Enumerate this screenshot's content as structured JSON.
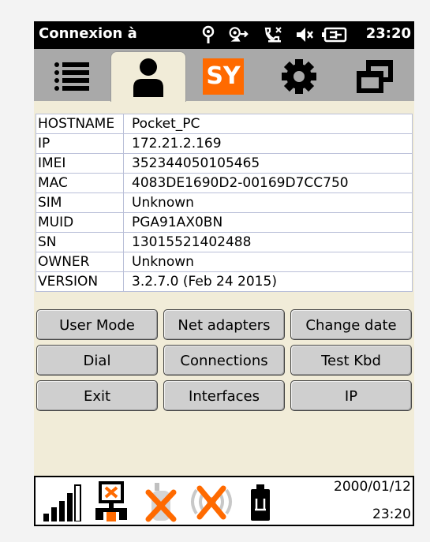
{
  "status_bar": {
    "title": "Connexion à",
    "time": "23:20",
    "icons": [
      "antenna-icon",
      "sync-icon",
      "phone-icon",
      "speaker-mute-icon",
      "battery-plug-icon"
    ]
  },
  "tabs": [
    {
      "name": "list",
      "icon": "list-icon",
      "active": false
    },
    {
      "name": "user",
      "icon": "user-icon",
      "active": true
    },
    {
      "name": "sy",
      "icon": "sy-logo-icon",
      "label": "SY",
      "active": false
    },
    {
      "name": "settings",
      "icon": "gear-icon",
      "active": false
    },
    {
      "name": "windows",
      "icon": "windows-icon",
      "active": false
    }
  ],
  "info": {
    "rows": [
      {
        "key": "HOSTNAME",
        "value": "Pocket_PC"
      },
      {
        "key": "IP",
        "value": "172.21.2.169"
      },
      {
        "key": "IMEI",
        "value": "352344050105465"
      },
      {
        "key": "MAC",
        "value": "4083DE1690D2-00169D7CC750"
      },
      {
        "key": "SIM",
        "value": "Unknown"
      },
      {
        "key": "MUID",
        "value": "PGA91AX0BN"
      },
      {
        "key": "SN",
        "value": "13015521402488"
      },
      {
        "key": "OWNER",
        "value": "Unknown"
      },
      {
        "key": "VERSION",
        "value": "3.2.7.0 (Feb 24 2015)"
      }
    ]
  },
  "buttons": {
    "user_mode": "User Mode",
    "net_adapters": "Net adapters",
    "change_date": "Change date",
    "dial": "Dial",
    "connections": "Connections",
    "test_kbd": "Test Kbd",
    "exit": "Exit",
    "interfaces": "Interfaces",
    "ip": "IP"
  },
  "bottom_bar": {
    "date": "2000/01/12",
    "time": "23:20",
    "icons": [
      "signal-bars-icon",
      "network-disconnected-icon",
      "gps-disabled-icon",
      "wireless-disabled-icon",
      "battery-icon"
    ]
  },
  "colors": {
    "background": "#f1ecd8",
    "accent_orange": "#ff6a00",
    "status_bar": "#000000",
    "tab_bar": "#a9a9a9"
  }
}
